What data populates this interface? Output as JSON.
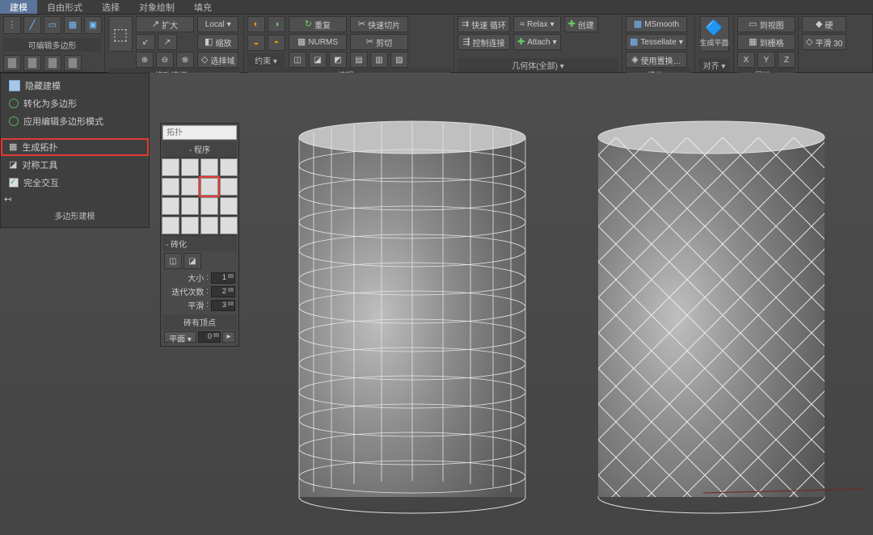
{
  "tabs": [
    "建模",
    "自由形式",
    "选择",
    "对象绘制",
    "填充"
  ],
  "active_tab": 0,
  "ribbon": {
    "panel1": {
      "label": "可编辑多边形"
    },
    "panel2": {
      "label": "修改选择",
      "btn_expand": "扩大",
      "btn_local": "Local",
      "btn_scale": "缩放",
      "btn_selfield": "选择域"
    },
    "panel3": {
      "label": "编辑",
      "items": [
        "重复",
        "快速切片",
        "快速 循环",
        "Relax",
        "创建",
        "NURMS",
        "剪切",
        "控制连接",
        "Attach",
        ""
      ]
    },
    "panel4": {
      "label": "几何体(全部)",
      "items": [
        "MSmooth",
        "Tessellate",
        "使用置换…"
      ]
    },
    "panel5": {
      "label": "细分",
      "btn": "生成平面"
    },
    "panel6": {
      "label": "对齐",
      "items": [
        "到视图",
        "到栅格",
        "X",
        "Y",
        "Z"
      ]
    },
    "panel7": {
      "label": "属性",
      "items": [
        "硬",
        "平滑 30"
      ]
    }
  },
  "side_menu": {
    "items": [
      "隐藏建模",
      "转化为多边形",
      "应用编辑多边形模式"
    ],
    "highlight": "生成拓扑",
    "mid": "对称工具",
    "checkbox": "完全交互",
    "footer": "多边形建模"
  },
  "topo": {
    "placeholder": "拓扑",
    "section_proc": "程序",
    "section_sub": "砖化",
    "rows": [
      {
        "label": "大小",
        "val": "1"
      },
      {
        "label": "迭代次数",
        "val": "2"
      },
      {
        "label": "平滑",
        "val": "3"
      }
    ],
    "vertex_label": "砖有顶点",
    "bottom_label": "平面",
    "bottom_val": "0"
  }
}
